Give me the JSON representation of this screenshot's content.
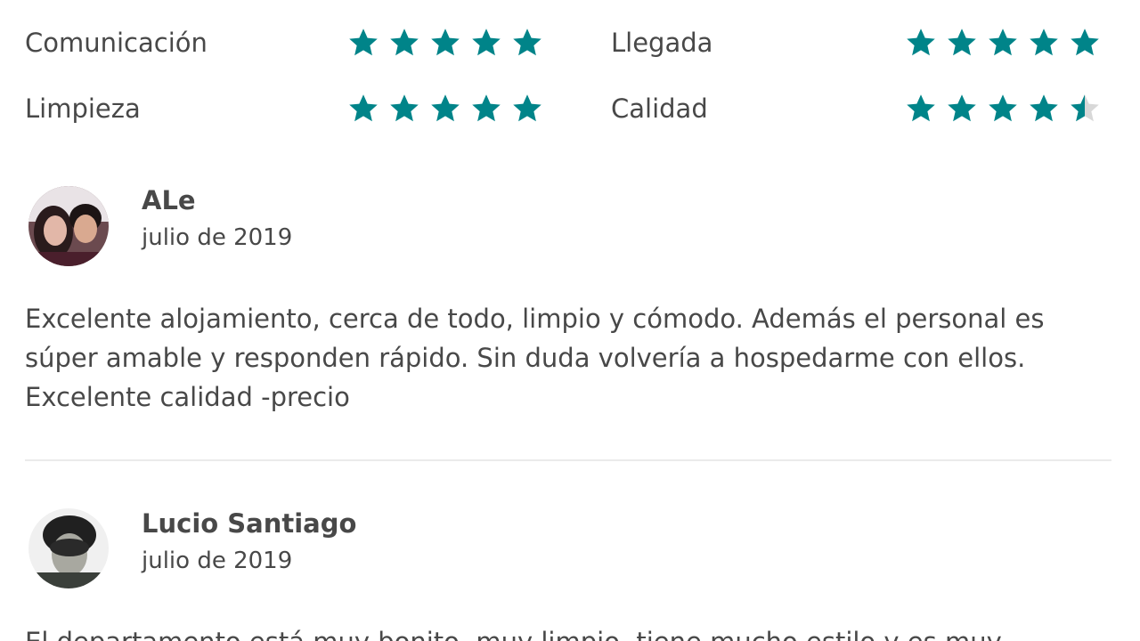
{
  "ratings": [
    {
      "label": "Comunicación",
      "value": 5
    },
    {
      "label": "Llegada",
      "value": 5
    },
    {
      "label": "Limpieza",
      "value": 5
    },
    {
      "label": "Calidad",
      "value": 4.5
    }
  ],
  "rating_max": 5,
  "colors": {
    "star": "#008489",
    "star_empty": "#d8d8d8",
    "text": "#484848",
    "divider": "#ebebeb"
  },
  "reviews": [
    {
      "name": "ALe",
      "date": "julio de 2019",
      "text": "Excelente alojamiento, cerca de todo, limpio y cómodo. Además el personal es súper amable y responden rápido. Sin duda volvería a hospedarme con ellos. Excelente calidad -precio",
      "avatar_icon": "user-photo-icon"
    },
    {
      "name": "Lucio Santiago",
      "date": "julio de 2019",
      "text": "El departamento está muy bonito, muy limpio, tiene mucho estilo y es muy",
      "avatar_icon": "user-photo-icon"
    }
  ]
}
